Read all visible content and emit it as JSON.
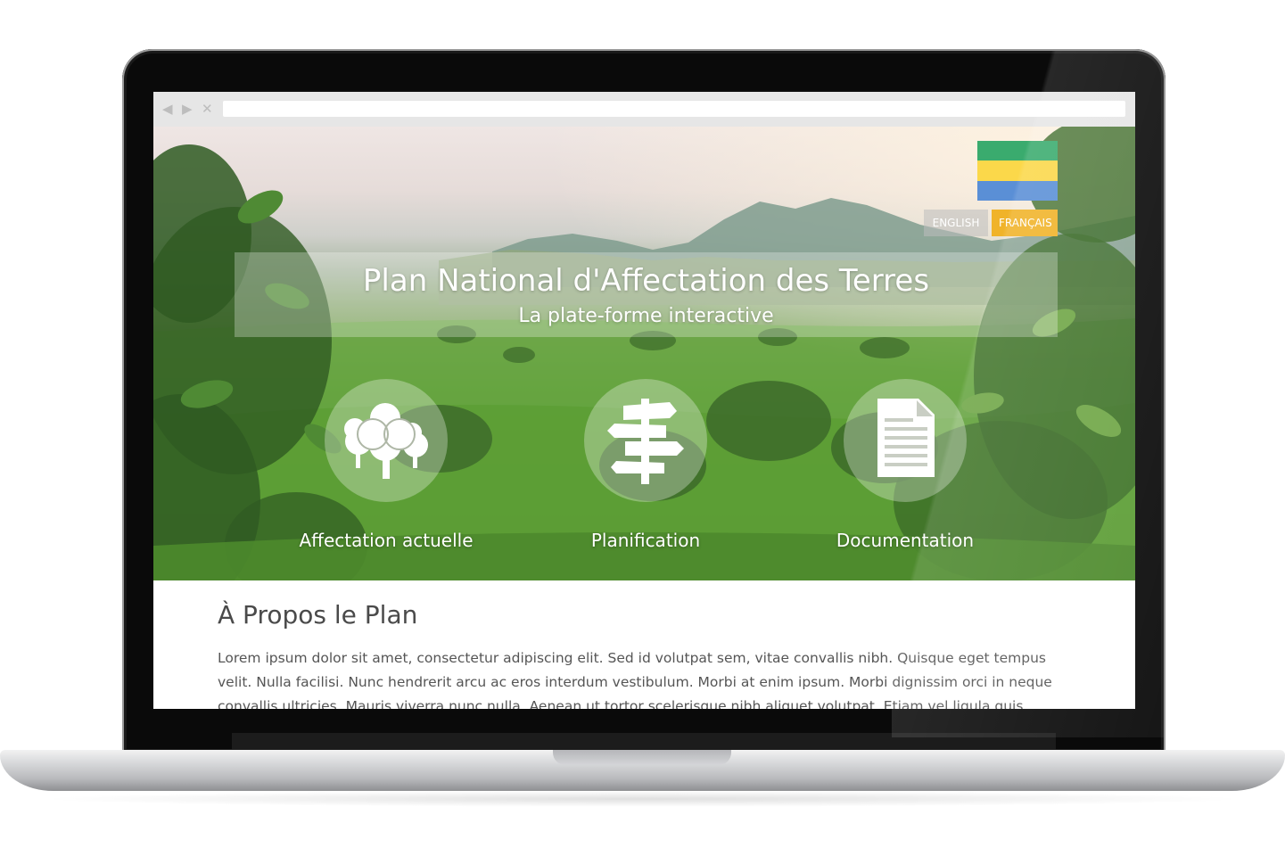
{
  "browser": {
    "back_icon": "◀",
    "forward_icon": "▶",
    "close_icon": "✕"
  },
  "hero": {
    "title": "Plan National d'Affectation des Terres",
    "subtitle": "La plate-forme interactive",
    "flag_colors": [
      "#3aab6e",
      "#fbd84a",
      "#5a8fd6"
    ],
    "languages": [
      {
        "label": "ENGLISH",
        "active": false
      },
      {
        "label": "FRANÇAIS",
        "active": true
      }
    ],
    "features": [
      {
        "label": "Affectation actuelle",
        "icon": "trees-icon"
      },
      {
        "label": "Planification",
        "icon": "signpost-icon"
      },
      {
        "label": "Documentation",
        "icon": "document-icon"
      }
    ]
  },
  "about": {
    "title": "À Propos le Plan",
    "body": "Lorem ipsum dolor sit amet, consectetur adipiscing elit. Sed id volutpat sem, vitae convallis nibh. Quisque eget tempus velit. Nulla facilisi. Nunc hendrerit arcu ac eros interdum vestibulum. Morbi at enim ipsum. Morbi dignissim orci in neque convallis ultricies. Mauris viverra nunc nulla. Aenean ut tortor scelerisque nibh aliquet volutpat. Etiam vel ligula quis sapien pulvinar"
  },
  "colors": {
    "accent": "#f0b329",
    "text": "#555555"
  }
}
